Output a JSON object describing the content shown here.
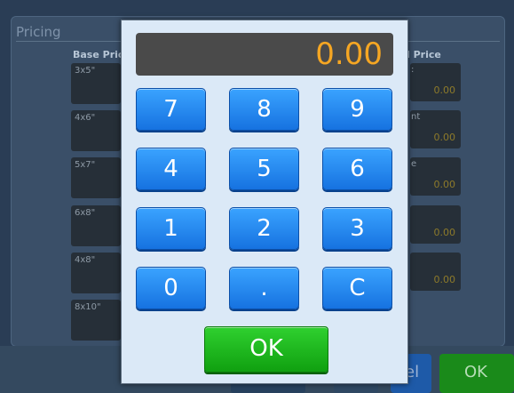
{
  "background": {
    "title": "Pricing",
    "headers": {
      "base_price": "Base Pric",
      "final_price": "l Price"
    },
    "sizes": [
      "3x5\"",
      "4x6\"",
      "5x7\"",
      "6x8\"",
      "4x8\"",
      "8x10\""
    ],
    "right_column": [
      {
        "label": ":",
        "value": "0.00"
      },
      {
        "label": "nt",
        "value": "0.00"
      },
      {
        "label": "e",
        "value": "0.00"
      },
      {
        "label": "",
        "value": "0.00"
      },
      {
        "label": "",
        "value": "0.00"
      }
    ],
    "cancel_label": "el",
    "ok_label": "OK",
    "mid_label": "•••"
  },
  "keypad": {
    "display_value": "0.00",
    "keys": [
      "7",
      "8",
      "9",
      "4",
      "5",
      "6",
      "1",
      "2",
      "3",
      "0",
      ".",
      "C"
    ],
    "ok_label": "OK"
  },
  "colors": {
    "display_text": "#f5a623",
    "key_blue": "#1f86f0",
    "ok_green": "#16b016",
    "dialog_bg": "#dbe9f7"
  }
}
